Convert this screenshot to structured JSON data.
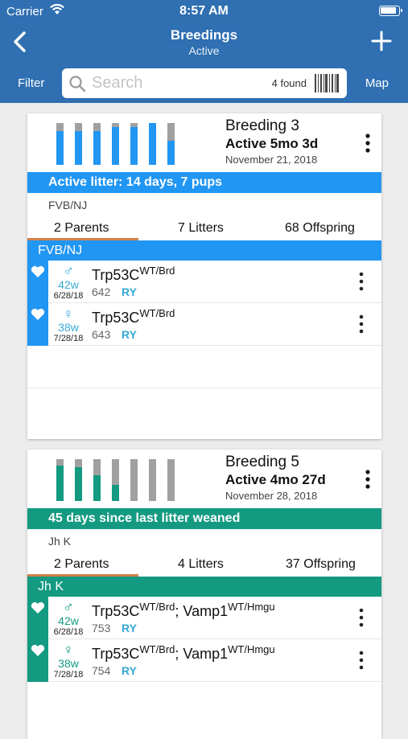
{
  "status_bar": {
    "carrier": "Carrier",
    "time": "8:57 AM"
  },
  "nav": {
    "title": "Breedings",
    "subtitle": "Active",
    "filter": "Filter",
    "map": "Map"
  },
  "search": {
    "placeholder": "Search",
    "found": "4 found"
  },
  "colors": {
    "header": "#2f6fb2",
    "blue": "#2196f3",
    "teal": "#139a81",
    "gray": "#a0a0a0",
    "tab_underline": "#d2824a"
  },
  "breedings": [
    {
      "title": "Breeding 3",
      "status": "Active 5mo 3d",
      "date": "November 21, 2018",
      "banner": "Active litter: 14 days, 7 pups",
      "strain": "FVB/NJ",
      "tabs": [
        "2 Parents",
        "7 Litters",
        "68 Offspring"
      ],
      "group": "FVB/NJ",
      "litter_bar_fill": [
        0.8,
        0.8,
        0.8,
        0.9,
        0.9,
        1.0,
        0.57
      ],
      "parents": [
        {
          "sex": "♂",
          "age": "42w",
          "dob": "6/28/18",
          "genotype": "Trp53C",
          "allele": "WT/Brd",
          "genotype2": "",
          "allele2": "",
          "id": "642",
          "tag": "RY"
        },
        {
          "sex": "♀",
          "age": "38w",
          "dob": "7/28/18",
          "genotype": "Trp53C",
          "allele": "WT/Brd",
          "genotype2": "",
          "allele2": "",
          "id": "643",
          "tag": "RY"
        }
      ]
    },
    {
      "title": "Breeding 5",
      "status": "Active 4mo 27d",
      "date": "November 28, 2018",
      "banner": "45 days since last litter weaned",
      "strain": "Jh K",
      "tabs": [
        "2 Parents",
        "4 Litters",
        "37 Offspring"
      ],
      "group": "Jh K",
      "litter_bar_fill": [
        0.85,
        0.8,
        0.62,
        0.38,
        0.0,
        0.0,
        0.0
      ],
      "parents": [
        {
          "sex": "♂",
          "age": "42w",
          "dob": "6/28/18",
          "genotype": "Trp53C",
          "allele": "WT/Brd",
          "genotype2": "; Vamp1",
          "allele2": "WT/Hmgu",
          "id": "753",
          "tag": "RY"
        },
        {
          "sex": "♀",
          "age": "38w",
          "dob": "7/28/18",
          "genotype": "Trp53C",
          "allele": "WT/Brd",
          "genotype2": "; Vamp1",
          "allele2": "WT/Hmgu",
          "id": "754",
          "tag": "RY"
        }
      ]
    }
  ]
}
